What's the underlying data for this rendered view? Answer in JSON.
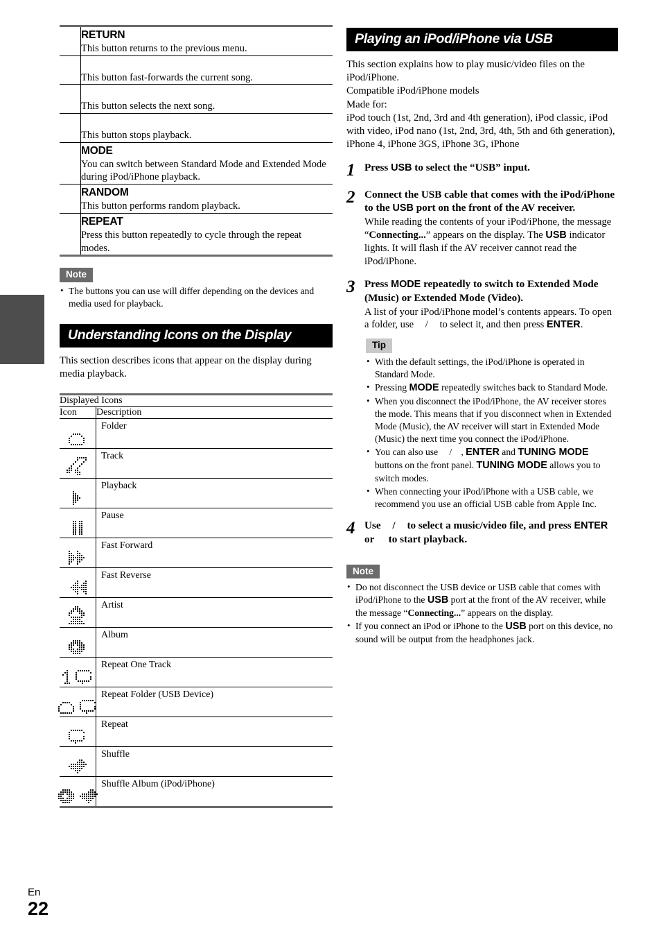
{
  "page": {
    "lang_label": "En",
    "number": "22"
  },
  "left_column": {
    "button_table": {
      "rows": [
        {
          "key": "RETURN",
          "desc": "This button returns to the previous menu."
        },
        {
          "key": "",
          "desc": "This button fast-forwards the current song."
        },
        {
          "key": "",
          "desc": "This button selects the next song."
        },
        {
          "key": "",
          "desc": "This button stops playback."
        },
        {
          "key": "MODE",
          "desc": "You can switch between Standard Mode and Extended Mode during iPod/iPhone playback."
        },
        {
          "key": "RANDOM",
          "desc": "This button performs random playback."
        },
        {
          "key": "REPEAT",
          "desc": "Press this button repeatedly to cycle through the repeat modes."
        }
      ]
    },
    "note": {
      "label": "Note",
      "bullets": [
        "The buttons you can use will differ depending on the devices and media used for playback."
      ]
    },
    "section": {
      "title": "Understanding Icons on the Display",
      "intro": "This section describes icons that appear on the display during media playback."
    },
    "icon_table": {
      "caption": "Displayed Icons",
      "col_icon": "Icon",
      "col_description": "Description",
      "rows": [
        {
          "icon_name": "folder-icon",
          "description": "Folder"
        },
        {
          "icon_name": "track-note-icon",
          "description": "Track"
        },
        {
          "icon_name": "playback-icon",
          "description": "Playback"
        },
        {
          "icon_name": "pause-icon",
          "description": "Pause"
        },
        {
          "icon_name": "fast-forward-icon",
          "description": "Fast Forward"
        },
        {
          "icon_name": "fast-reverse-icon",
          "description": "Fast Reverse"
        },
        {
          "icon_name": "artist-icon",
          "description": "Artist"
        },
        {
          "icon_name": "album-icon",
          "description": "Album"
        },
        {
          "icon_name": "repeat-one-track-icon",
          "description": "Repeat One Track"
        },
        {
          "icon_name": "repeat-folder-icon",
          "description": "Repeat Folder (USB Device)"
        },
        {
          "icon_name": "repeat-icon",
          "description": "Repeat"
        },
        {
          "icon_name": "shuffle-icon",
          "description": "Shuffle"
        },
        {
          "icon_name": "shuffle-album-icon",
          "description": "Shuffle Album (iPod/iPhone)"
        }
      ]
    }
  },
  "right_column": {
    "section": {
      "title": "Playing an iPod/iPhone via USB",
      "intro_lines": [
        "This section explains how to play music/video files on the iPod/iPhone.",
        "Compatible iPod/iPhone models",
        "Made for:",
        "iPod touch (1st, 2nd, 3rd and 4th generation), iPod classic, iPod with video, iPod nano (1st, 2nd, 3rd, 4th, 5th and 6th generation), iPhone 4, iPhone 3GS, iPhone 3G, iPhone"
      ]
    },
    "steps": [
      {
        "num": "1",
        "head_parts": [
          {
            "t": "Press ",
            "s": "serif-b"
          },
          {
            "t": "USB",
            "s": "sans-b"
          },
          {
            "t": " to select the “USB” input.",
            "s": "serif-b"
          }
        ],
        "sub_parts": []
      },
      {
        "num": "2",
        "head_parts": [
          {
            "t": "Connect the USB cable that comes with the iPod/iPhone to the ",
            "s": "serif-b"
          },
          {
            "t": "USB",
            "s": "sans-b"
          },
          {
            "t": " port on the front of the AV receiver.",
            "s": "serif-b"
          }
        ],
        "sub_parts": [
          {
            "t": "While reading the contents of your iPod/iPhone, the message “",
            "s": ""
          },
          {
            "t": "Connecting...",
            "s": "serif-b"
          },
          {
            "t": "” appears on the display. The ",
            "s": ""
          },
          {
            "t": "USB",
            "s": "sans-b"
          },
          {
            "t": " indicator lights. It will flash if the AV receiver cannot read the iPod/iPhone.",
            "s": ""
          }
        ]
      },
      {
        "num": "3",
        "head_parts": [
          {
            "t": "Press ",
            "s": "serif-b"
          },
          {
            "t": "MODE",
            "s": "sans-b"
          },
          {
            "t": " repeatedly to switch to Extended Mode (Music) or Extended Mode (Video).",
            "s": "serif-b"
          }
        ],
        "sub_parts": [
          {
            "t": "A list of your iPod/iPhone model’s contents appears. To open a folder, use ",
            "s": ""
          },
          {
            "t": "",
            "s": "gap"
          },
          {
            "t": "/",
            "s": ""
          },
          {
            "t": "",
            "s": "gap"
          },
          {
            "t": " to select it, and then press ",
            "s": ""
          },
          {
            "t": "ENTER",
            "s": "sans-b"
          },
          {
            "t": ".",
            "s": ""
          }
        ]
      },
      {
        "num": "4",
        "head_parts": [
          {
            "t": "Use ",
            "s": "serif-b"
          },
          {
            "t": "",
            "s": "gap"
          },
          {
            "t": "/",
            "s": "serif-b"
          },
          {
            "t": "",
            "s": "gap"
          },
          {
            "t": " to select a music/video file, and press ",
            "s": "serif-b"
          },
          {
            "t": "ENTER",
            "s": "sans-b"
          },
          {
            "t": " or ",
            "s": "serif-b"
          },
          {
            "t": "",
            "s": "gap"
          },
          {
            "t": " to start playback.",
            "s": "serif-b"
          }
        ],
        "sub_parts": []
      }
    ],
    "tip": {
      "label": "Tip",
      "bullets": [
        [
          {
            "t": "With the default settings, the iPod/iPhone is operated in Standard Mode.",
            "s": ""
          }
        ],
        [
          {
            "t": "Pressing ",
            "s": ""
          },
          {
            "t": "MODE",
            "s": "sans-b"
          },
          {
            "t": " repeatedly switches back to Standard Mode.",
            "s": ""
          }
        ],
        [
          {
            "t": "When you disconnect the iPod/iPhone, the AV receiver stores the mode. This means that if you disconnect when in Extended Mode (Music), the AV receiver will start in Extended Mode (Music) the next time you connect the iPod/iPhone.",
            "s": ""
          }
        ],
        [
          {
            "t": "You can also use ",
            "s": ""
          },
          {
            "t": "",
            "s": "gap"
          },
          {
            "t": "/",
            "s": ""
          },
          {
            "t": "",
            "s": "gap"
          },
          {
            "t": ", ",
            "s": ""
          },
          {
            "t": "ENTER",
            "s": "sans-b"
          },
          {
            "t": " and ",
            "s": ""
          },
          {
            "t": "TUNING MODE",
            "s": "sans-b"
          },
          {
            "t": " buttons on the front panel. ",
            "s": ""
          },
          {
            "t": "TUNING MODE",
            "s": "sans-b"
          },
          {
            "t": " allows you to switch modes.",
            "s": ""
          }
        ],
        [
          {
            "t": "When connecting your iPod/iPhone with a USB cable, we recommend you use an official USB cable from Apple Inc.",
            "s": ""
          }
        ]
      ]
    },
    "note": {
      "label": "Note",
      "bullets": [
        [
          {
            "t": "Do not disconnect the USB device or USB cable that comes with iPod/iPhone to the ",
            "s": ""
          },
          {
            "t": "USB",
            "s": "sans-b"
          },
          {
            "t": " port at the front of the AV receiver, while the message “",
            "s": ""
          },
          {
            "t": "Connecting...",
            "s": "serif-b"
          },
          {
            "t": "” appears on the display.",
            "s": ""
          }
        ],
        [
          {
            "t": "If you connect an iPod or iPhone to the ",
            "s": ""
          },
          {
            "t": "USB",
            "s": "sans-b"
          },
          {
            "t": " port on this device, no sound will be output from the headphones jack.",
            "s": ""
          }
        ]
      ]
    }
  },
  "icon_pixels": {
    "folder-icon": {
      "w": 9,
      "rows": [
        "001111000",
        "010000100",
        "100000010",
        "100000010",
        "100000010",
        "011111100"
      ]
    },
    "track-note-icon": {
      "w": 11,
      "rows": [
        "00000111110",
        "00000100010",
        "00001000100",
        "00010001000",
        "00100010000",
        "01100100000",
        "11101100000",
        "11001110000",
        "00000110000"
      ]
    },
    "playback-icon": {
      "w": 5,
      "rows": [
        "10000",
        "11000",
        "11100",
        "11110",
        "11100",
        "11000",
        "10000"
      ]
    },
    "pause-icon": {
      "w": 5,
      "rows": [
        "11011",
        "11011",
        "11011",
        "11011",
        "11011",
        "11011",
        "11011"
      ]
    },
    "fast-forward-icon": {
      "w": 9,
      "rows": [
        "100010000",
        "110011000",
        "111011100",
        "111111110",
        "111011100",
        "110011000",
        "100010000"
      ]
    },
    "fast-reverse-icon": {
      "w": 9,
      "rows": [
        "000010001",
        "000110011",
        "001110111",
        "011111111",
        "001110111",
        "000110011",
        "000010001"
      ]
    },
    "artist-icon": {
      "w": 9,
      "rows": [
        "000110000",
        "001111000",
        "011011100",
        "110001110",
        "100000110",
        "011111100",
        "001111000",
        "011111100",
        "111111110"
      ]
    },
    "album-icon": {
      "w": 9,
      "rows": [
        "001111000",
        "011111100",
        "111011110",
        "110001110",
        "111011110",
        "011111100",
        "001111000"
      ]
    },
    "repeat-one-track-icon": {
      "w": 5,
      "rows": [
        "00100",
        "01100",
        "10100",
        "00100",
        "00100",
        "00100",
        "01110"
      ]
    },
    "repeat-icon": {
      "w": 9,
      "rows": [
        "011111100",
        "100000010",
        "100000000",
        "100000010",
        "100000010",
        "011111100",
        "000100000"
      ]
    },
    "shuffle-icon": {
      "w": 9,
      "rows": [
        "000001100",
        "000011110",
        "011111111",
        "111111110",
        "011111100",
        "000111000",
        "000010000"
      ]
    }
  }
}
